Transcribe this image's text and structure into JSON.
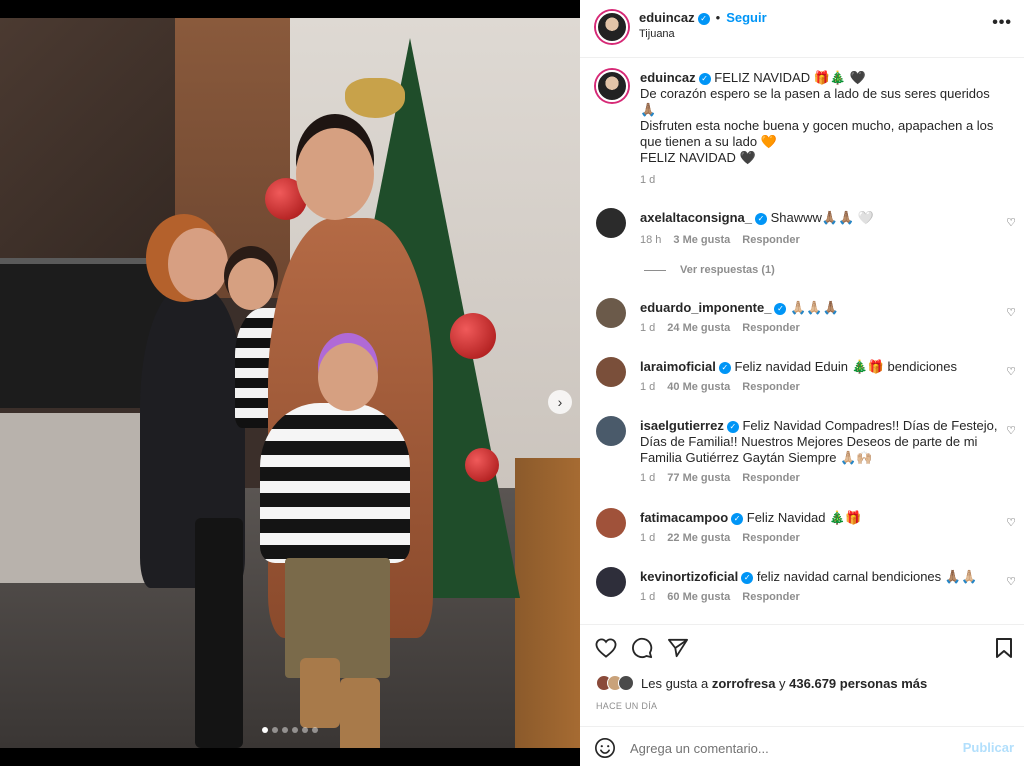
{
  "post": {
    "author": "eduincaz",
    "follow_label": "Seguir",
    "separator": "•",
    "location": "Tijuana",
    "more": "•••",
    "dots_total": 6,
    "dots_active": 1
  },
  "caption": {
    "username": "eduincaz",
    "line1": "FELIZ NAVIDAD 🎁🎄 🖤",
    "line2": "De corazón espero se la pasen a lado de sus seres queridos 🙏🏽",
    "line3": "Disfruten esta noche buena y gocen mucho, apapachen a los que tienen a su lado 🧡",
    "line4": "FELIZ NAVIDAD 🖤",
    "time": "1 d"
  },
  "comments": [
    {
      "username": "axelaltaconsigna_",
      "text": "Shawww🙏🏽🙏🏽 🤍",
      "time": "18 h",
      "likes": "3 Me gusta",
      "reply": "Responder",
      "avatar_color": "#2b2b2b"
    },
    {
      "username": "eduardo_imponente_",
      "text": "🙏🏼🙏🏼🙏🏽",
      "time": "1 d",
      "likes": "24 Me gusta",
      "reply": "Responder",
      "avatar_color": "#6b5a4a"
    },
    {
      "username": "laraimoficial",
      "text": "Feliz navidad Eduin 🎄🎁 bendiciones",
      "time": "1 d",
      "likes": "40 Me gusta",
      "reply": "Responder",
      "avatar_color": "#7a4f3a"
    },
    {
      "username": "isaelgutierrez",
      "text": "Feliz Navidad Compadres!! Días de Festejo, Días de Familia!! Nuestros Mejores Deseos de parte de mi Familia Gutiérrez Gaytán Siempre 🙏🏼🙌🏼",
      "time": "1 d",
      "likes": "77 Me gusta",
      "reply": "Responder",
      "avatar_color": "#4a5a6a"
    },
    {
      "username": "fatimacampoo",
      "text": "Feliz Navidad 🎄🎁",
      "time": "1 d",
      "likes": "22 Me gusta",
      "reply": "Responder",
      "avatar_color": "#a0523a"
    },
    {
      "username": "kevinortizoficial",
      "text": "feliz navidad carnal bendiciones 🙏🏽🙏🏼",
      "time": "1 d",
      "likes": "60 Me gusta",
      "reply": "Responder",
      "avatar_color": "#2e2e3a"
    }
  ],
  "view_replies": "Ver respuestas (1)",
  "actions": {
    "likes_prefix": "Les gusta a",
    "likes_user": "zorrofresa",
    "likes_middle": "y",
    "likes_count": "436.679 personas más",
    "time_ago": "HACE UN DÍA"
  },
  "add_comment": {
    "placeholder": "Agrega un comentario...",
    "publish": "Publicar"
  }
}
